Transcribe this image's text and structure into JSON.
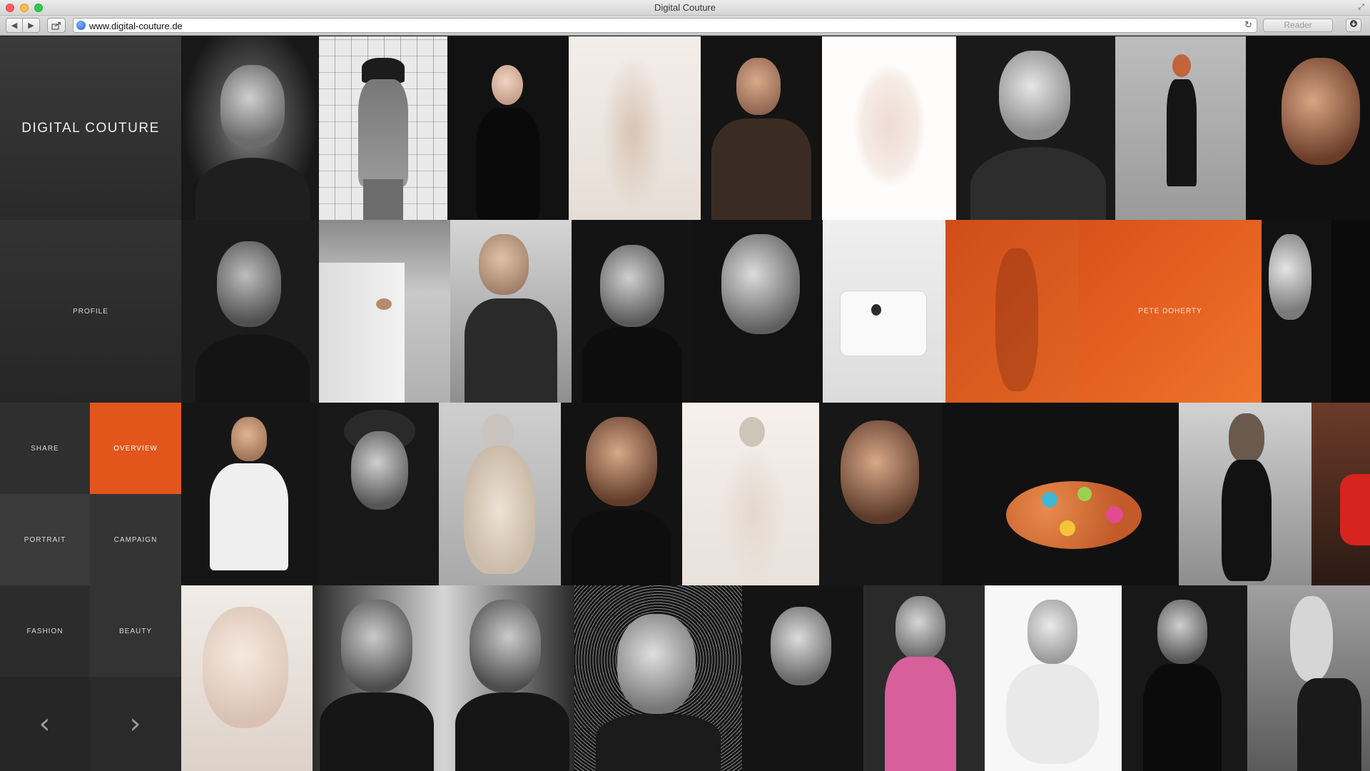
{
  "window": {
    "title": "Digital Couture"
  },
  "browser": {
    "url": "www.digital-couture.de",
    "reader_label": "Reader",
    "back_icon": "◀",
    "forward_icon": "▶",
    "reload_icon": "↻"
  },
  "site": {
    "brand": "DIGITAL COUTURE",
    "nav": {
      "profile": "PROFILE",
      "share": "SHARE",
      "overview": "OVERVIEW",
      "portrait": "PORTRAIT",
      "campaign": "CAMPAIGN",
      "fashion": "FASHION",
      "beauty": "BEAUTY",
      "prev_icon": "‹",
      "next_icon": "›"
    },
    "highlight_label": "PETE DOHERTY"
  },
  "colors": {
    "accent": "#e2561c",
    "accent_dark": "#c9461a"
  }
}
